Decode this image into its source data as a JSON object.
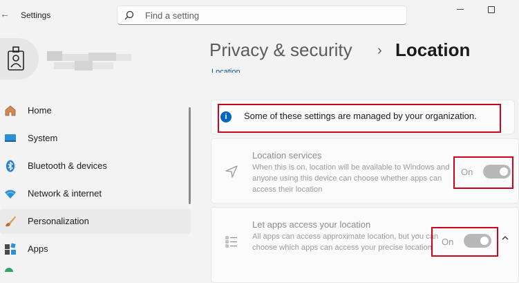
{
  "titlebar": {
    "back_glyph": "←",
    "app_title": "Settings"
  },
  "search": {
    "placeholder": "Find a setting"
  },
  "sidebar": {
    "items": [
      {
        "label": "Home",
        "icon": "home-icon"
      },
      {
        "label": "System",
        "icon": "system-icon"
      },
      {
        "label": "Bluetooth & devices",
        "icon": "bluetooth-icon"
      },
      {
        "label": "Network & internet",
        "icon": "wifi-icon"
      },
      {
        "label": "Personalization",
        "icon": "brush-icon",
        "selected": true
      },
      {
        "label": "Apps",
        "icon": "apps-icon"
      }
    ]
  },
  "header": {
    "parent": "Privacy & security",
    "separator": "›",
    "current": "Location",
    "link_partial": "Location"
  },
  "notice": {
    "text": "Some of these settings are managed by your organization."
  },
  "settings": [
    {
      "title": "Location services",
      "description": "When this is on, location will be available to Windows and anyone using this device can choose whether apps can access their location",
      "toggle_label": "On",
      "icon": "location-arrow-icon"
    },
    {
      "title": "Let apps access your location",
      "description": "All apps can access approximate location, but you can choose which apps can access your precise location",
      "toggle_label": "On",
      "icon": "app-list-icon",
      "expanded": true
    }
  ],
  "colors": {
    "accent": "#0067c0",
    "highlight": "#d0021b"
  }
}
